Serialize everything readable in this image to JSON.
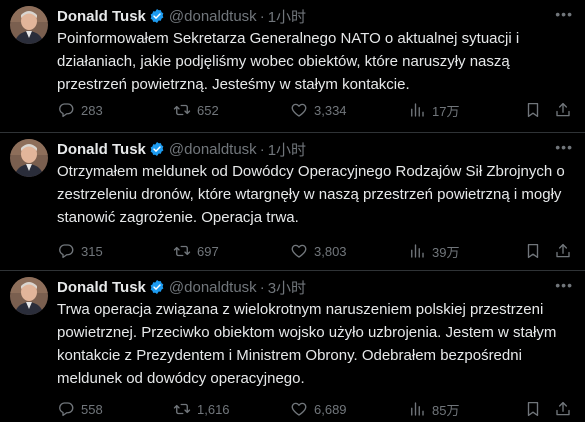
{
  "colors": {
    "background": "#000000",
    "text": "#e7e9ea",
    "muted": "#71767b",
    "verified": "#1d9bf0",
    "divider": "#2f3336"
  },
  "tweets": [
    {
      "name": "Donald Tusk",
      "handle": "@donaldtusk",
      "separator": "·",
      "time": "1小时",
      "text": "Poinformowałem Sekretarza Generalnego NATO o aktualnej sytuacji i działaniach, jakie podjęliśmy wobec obiektów, które naruszyły naszą przestrzeń powietrzną. Jesteśmy w stałym kontakcie.",
      "replies": "283",
      "retweets": "652",
      "likes": "3,334",
      "views": "17万"
    },
    {
      "name": "Donald Tusk",
      "handle": "@donaldtusk",
      "separator": "·",
      "time": "1小时",
      "text": "Otrzymałem meldunek od Dowódcy Operacyjnego Rodzajów Sił Zbrojnych o zestrzeleniu dronów, które wtargnęły w naszą przestrzeń powietrzną i mogły stanowić zagrożenie. Operacja trwa.",
      "replies": "315",
      "retweets": "697",
      "likes": "3,803",
      "views": "39万"
    },
    {
      "name": "Donald Tusk",
      "handle": "@donaldtusk",
      "separator": "·",
      "time": "3小时",
      "text": "Trwa operacja związana z wielokrotnym naruszeniem polskiej przestrzeni powietrznej. Przeciwko obiektom wojsko użyło uzbrojenia. Jestem w stałym kontakcie z Prezydentem i Ministrem Obrony. Odebrałem bezpośredni meldunek od dowódcy operacyjnego.",
      "replies": "558",
      "retweets": "1,616",
      "likes": "6,689",
      "views": "85万"
    }
  ]
}
